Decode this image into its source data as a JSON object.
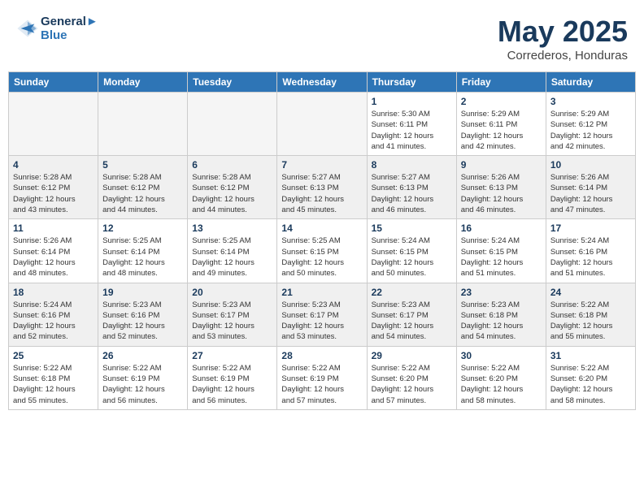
{
  "header": {
    "logo_line1": "General",
    "logo_line2": "Blue",
    "month_title": "May 2025",
    "location": "Correderos, Honduras"
  },
  "weekdays": [
    "Sunday",
    "Monday",
    "Tuesday",
    "Wednesday",
    "Thursday",
    "Friday",
    "Saturday"
  ],
  "weeks": [
    [
      {
        "day": "",
        "info": ""
      },
      {
        "day": "",
        "info": ""
      },
      {
        "day": "",
        "info": ""
      },
      {
        "day": "",
        "info": ""
      },
      {
        "day": "1",
        "info": "Sunrise: 5:30 AM\nSunset: 6:11 PM\nDaylight: 12 hours\nand 41 minutes."
      },
      {
        "day": "2",
        "info": "Sunrise: 5:29 AM\nSunset: 6:11 PM\nDaylight: 12 hours\nand 42 minutes."
      },
      {
        "day": "3",
        "info": "Sunrise: 5:29 AM\nSunset: 6:12 PM\nDaylight: 12 hours\nand 42 minutes."
      }
    ],
    [
      {
        "day": "4",
        "info": "Sunrise: 5:28 AM\nSunset: 6:12 PM\nDaylight: 12 hours\nand 43 minutes."
      },
      {
        "day": "5",
        "info": "Sunrise: 5:28 AM\nSunset: 6:12 PM\nDaylight: 12 hours\nand 44 minutes."
      },
      {
        "day": "6",
        "info": "Sunrise: 5:28 AM\nSunset: 6:12 PM\nDaylight: 12 hours\nand 44 minutes."
      },
      {
        "day": "7",
        "info": "Sunrise: 5:27 AM\nSunset: 6:13 PM\nDaylight: 12 hours\nand 45 minutes."
      },
      {
        "day": "8",
        "info": "Sunrise: 5:27 AM\nSunset: 6:13 PM\nDaylight: 12 hours\nand 46 minutes."
      },
      {
        "day": "9",
        "info": "Sunrise: 5:26 AM\nSunset: 6:13 PM\nDaylight: 12 hours\nand 46 minutes."
      },
      {
        "day": "10",
        "info": "Sunrise: 5:26 AM\nSunset: 6:14 PM\nDaylight: 12 hours\nand 47 minutes."
      }
    ],
    [
      {
        "day": "11",
        "info": "Sunrise: 5:26 AM\nSunset: 6:14 PM\nDaylight: 12 hours\nand 48 minutes."
      },
      {
        "day": "12",
        "info": "Sunrise: 5:25 AM\nSunset: 6:14 PM\nDaylight: 12 hours\nand 48 minutes."
      },
      {
        "day": "13",
        "info": "Sunrise: 5:25 AM\nSunset: 6:14 PM\nDaylight: 12 hours\nand 49 minutes."
      },
      {
        "day": "14",
        "info": "Sunrise: 5:25 AM\nSunset: 6:15 PM\nDaylight: 12 hours\nand 50 minutes."
      },
      {
        "day": "15",
        "info": "Sunrise: 5:24 AM\nSunset: 6:15 PM\nDaylight: 12 hours\nand 50 minutes."
      },
      {
        "day": "16",
        "info": "Sunrise: 5:24 AM\nSunset: 6:15 PM\nDaylight: 12 hours\nand 51 minutes."
      },
      {
        "day": "17",
        "info": "Sunrise: 5:24 AM\nSunset: 6:16 PM\nDaylight: 12 hours\nand 51 minutes."
      }
    ],
    [
      {
        "day": "18",
        "info": "Sunrise: 5:24 AM\nSunset: 6:16 PM\nDaylight: 12 hours\nand 52 minutes."
      },
      {
        "day": "19",
        "info": "Sunrise: 5:23 AM\nSunset: 6:16 PM\nDaylight: 12 hours\nand 52 minutes."
      },
      {
        "day": "20",
        "info": "Sunrise: 5:23 AM\nSunset: 6:17 PM\nDaylight: 12 hours\nand 53 minutes."
      },
      {
        "day": "21",
        "info": "Sunrise: 5:23 AM\nSunset: 6:17 PM\nDaylight: 12 hours\nand 53 minutes."
      },
      {
        "day": "22",
        "info": "Sunrise: 5:23 AM\nSunset: 6:17 PM\nDaylight: 12 hours\nand 54 minutes."
      },
      {
        "day": "23",
        "info": "Sunrise: 5:23 AM\nSunset: 6:18 PM\nDaylight: 12 hours\nand 54 minutes."
      },
      {
        "day": "24",
        "info": "Sunrise: 5:22 AM\nSunset: 6:18 PM\nDaylight: 12 hours\nand 55 minutes."
      }
    ],
    [
      {
        "day": "25",
        "info": "Sunrise: 5:22 AM\nSunset: 6:18 PM\nDaylight: 12 hours\nand 55 minutes."
      },
      {
        "day": "26",
        "info": "Sunrise: 5:22 AM\nSunset: 6:19 PM\nDaylight: 12 hours\nand 56 minutes."
      },
      {
        "day": "27",
        "info": "Sunrise: 5:22 AM\nSunset: 6:19 PM\nDaylight: 12 hours\nand 56 minutes."
      },
      {
        "day": "28",
        "info": "Sunrise: 5:22 AM\nSunset: 6:19 PM\nDaylight: 12 hours\nand 57 minutes."
      },
      {
        "day": "29",
        "info": "Sunrise: 5:22 AM\nSunset: 6:20 PM\nDaylight: 12 hours\nand 57 minutes."
      },
      {
        "day": "30",
        "info": "Sunrise: 5:22 AM\nSunset: 6:20 PM\nDaylight: 12 hours\nand 58 minutes."
      },
      {
        "day": "31",
        "info": "Sunrise: 5:22 AM\nSunset: 6:20 PM\nDaylight: 12 hours\nand 58 minutes."
      }
    ]
  ]
}
